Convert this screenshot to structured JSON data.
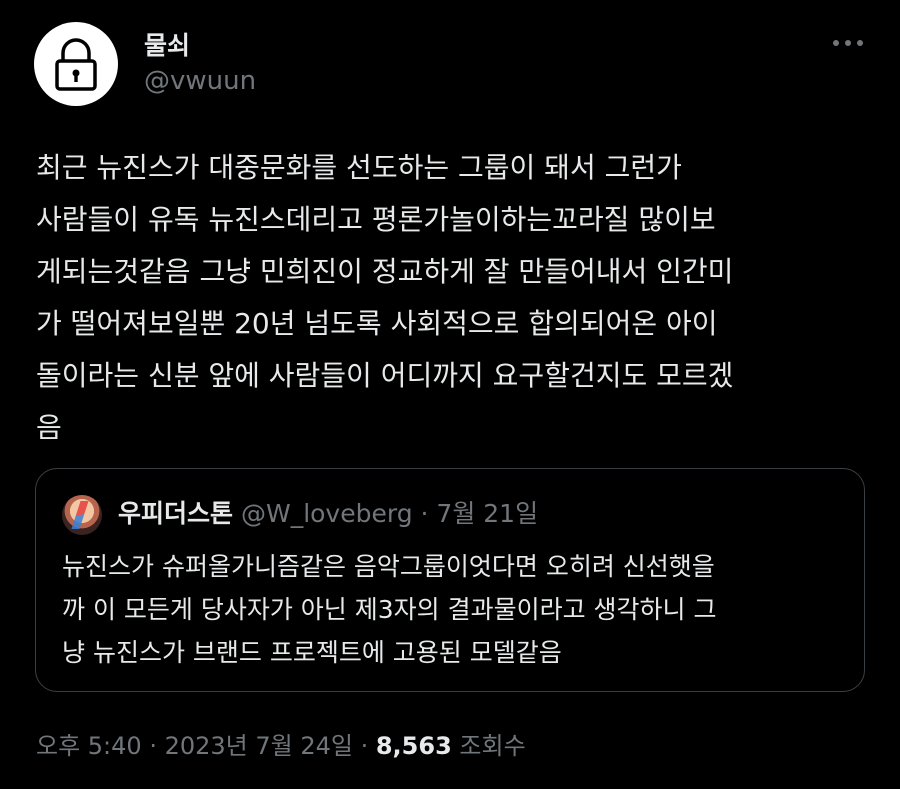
{
  "author": {
    "display_name": "물쇠",
    "handle": "@vwuun",
    "avatar_icon": "lock-icon"
  },
  "more_icon": "more-horizontal-icon",
  "tweet": {
    "text": "최근 뉴진스가 대중문화를 선도하는 그룹이 돼서 그런가\n사람들이 유독 뉴진스데리고 평론가놀이하는꼬라질 많이보\n게되는것같음 그냥 민희진이 정교하게 잘 만들어내서 인간미\n가 떨어져보일뿐 20년 넘도록 사회적으로 합의되어온 아이\n돌이라는 신분 앞에 사람들이 어디까지 요구할건지도 모르겠\n음"
  },
  "quote": {
    "display_name": "우피더스톤",
    "handle": "@W_loveberg",
    "separator": " · ",
    "date": "7월 21일",
    "text": "뉴진스가 슈퍼올가니즘같은 음악그룹이엇다면 오히려 신선햇을\n까 이 모든게 당사자가 아닌 제3자의 결과물이라고 생각하니 그\n냥 뉴진스가 브랜드 프로젝트에 고용된 모델같음"
  },
  "footer": {
    "time": "오후 5:40",
    "separator1": " · ",
    "date": "2023년 7월 24일",
    "separator2": " · ",
    "views_count": "8,563",
    "views_label": " 조회수"
  }
}
